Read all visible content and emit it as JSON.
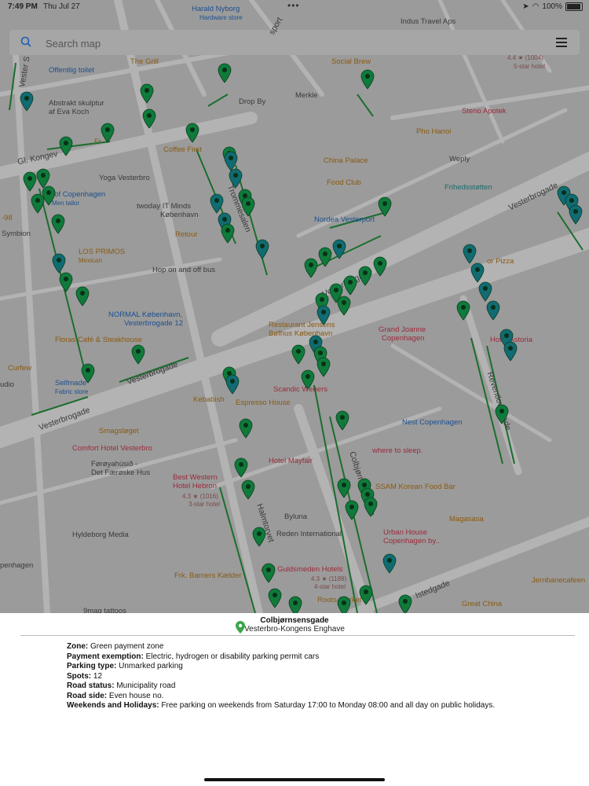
{
  "status_bar": {
    "time": "7:49 PM",
    "date": "Thu Jul 27",
    "battery": "100%"
  },
  "search": {
    "placeholder": "Search map"
  },
  "map": {
    "streets": [
      "Gl. Kongev",
      "Vesterbrogade",
      "Vesterbrogade",
      "Vesterbrogade",
      "Vesterbrogade",
      "Colbjørnsensgade",
      "Reventlowsgade",
      "Istedgade",
      "Trommesalen",
      "Halmtorvet",
      "Vester S",
      "sport"
    ],
    "pois": [
      {
        "name": "Harald Nyborg",
        "sub": "Hardware store",
        "kind": "b"
      },
      {
        "name": "Indus Travel Aps",
        "kind": "g"
      },
      {
        "name": "Offentlig toilet",
        "kind": "b"
      },
      {
        "name": "The Grill",
        "kind": "o"
      },
      {
        "name": "Social Brew",
        "kind": "o"
      },
      {
        "name": "4.4 ★ (1004)",
        "sub": "5-star hotel",
        "kind": "p"
      },
      {
        "name": "Abstrakt skulptur",
        "sub": "af Eva Koch",
        "kind": "g"
      },
      {
        "name": "Drop By",
        "kind": "g"
      },
      {
        "name": "Merkle",
        "kind": "g"
      },
      {
        "name": "Steno Apotek",
        "kind": "p"
      },
      {
        "name": "Pho Hanoi",
        "kind": "o"
      },
      {
        "name": "Coffee First",
        "kind": "o"
      },
      {
        "name": "Yoga Vesterbro",
        "kind": "g"
      },
      {
        "name": "China Palace",
        "kind": "o"
      },
      {
        "name": "Weply",
        "kind": "g"
      },
      {
        "name": "Food Club",
        "kind": "o"
      },
      {
        "name": "Frihedsstøtten",
        "kind": "t"
      },
      {
        "name": "nd of Copenhagen",
        "sub": "Men tailor",
        "kind": "b"
      },
      {
        "name": "twoday IT Minds",
        "sub": "København",
        "kind": "g"
      },
      {
        "name": "Nordea Vesterport",
        "kind": "b"
      },
      {
        "name": "Symbion",
        "kind": "g"
      },
      {
        "name": "Retour",
        "kind": "o"
      },
      {
        "name": "LOS PRIMOS",
        "sub": "Mexican",
        "kind": "o"
      },
      {
        "name": "Hop on and off bus",
        "kind": "g"
      },
      {
        "name": "or Pizza",
        "kind": "o"
      },
      {
        "name": "NORMAL København,",
        "sub": "Vesterbrogade 12",
        "kind": "b"
      },
      {
        "name": "Restaurant Jensens",
        "sub": "Bøfhus København",
        "kind": "o"
      },
      {
        "name": "Grand Joanne",
        "sub": "Copenhagen",
        "kind": "p"
      },
      {
        "name": "Hotel Astoria",
        "kind": "p"
      },
      {
        "name": "Floras Café & Steakhouse",
        "kind": "o"
      },
      {
        "name": "Curfew",
        "kind": "o"
      },
      {
        "name": "Selfmade",
        "sub": "Fabric store",
        "kind": "b"
      },
      {
        "name": "Scandic Webers",
        "kind": "p"
      },
      {
        "name": "Kebabish",
        "kind": "o"
      },
      {
        "name": "Espresso House",
        "kind": "o"
      },
      {
        "name": "Smagsløget",
        "kind": "o"
      },
      {
        "name": "Nest Copenhagen",
        "kind": "b"
      },
      {
        "name": "Comfort Hotel Vesterbro",
        "kind": "p"
      },
      {
        "name": "Hotel Mayfair",
        "kind": "p"
      },
      {
        "name": "where to sleep.",
        "kind": "p"
      },
      {
        "name": "Førøyahúsið -",
        "sub": "Det Færøske Hus",
        "kind": "g"
      },
      {
        "name": "Best Western",
        "sub": "Hotel Hebron",
        "kind": "p"
      },
      {
        "name": "4.3 ★ (1016)",
        "sub": "3-star hotel",
        "kind": "p"
      },
      {
        "name": "SSAM Korean Food Bar",
        "kind": "o"
      },
      {
        "name": "Byluna",
        "kind": "g"
      },
      {
        "name": "Magasasa",
        "kind": "o"
      },
      {
        "name": "Hyldeborg Media",
        "kind": "g"
      },
      {
        "name": "Reden International",
        "kind": "g"
      },
      {
        "name": "Urban House",
        "sub": "Copenhagen by..",
        "kind": "p"
      },
      {
        "name": "penhagen",
        "kind": "g"
      },
      {
        "name": "Frk. Barners Kælder",
        "kind": "o"
      },
      {
        "name": "Axel Guldsmeden Hotels",
        "kind": "p"
      },
      {
        "name": "4.3 ★ (1189)",
        "sub": "4-star hotel",
        "kind": "p"
      },
      {
        "name": "Jernbanecafeen",
        "kind": "o"
      },
      {
        "name": "Roots Market",
        "kind": "o"
      },
      {
        "name": "Great China",
        "kind": "o"
      },
      {
        "name": "9mag tattoos",
        "kind": "g"
      },
      {
        "name": "udio",
        "kind": "g"
      },
      {
        "name": "-98",
        "kind": "o"
      },
      {
        "name": "Fr",
        "kind": "o"
      }
    ]
  },
  "panel": {
    "title": "Colbjørnsensgade",
    "subtitle": "Vesterbro-Kongens Enghave",
    "details": [
      {
        "label": "Zone:",
        "value": "Green payment zone"
      },
      {
        "label": "Payment exemption:",
        "value": "Electric, hydrogen or disability parking permit cars"
      },
      {
        "label": "Parking type:",
        "value": "Unmarked parking"
      },
      {
        "label": "Spots:",
        "value": "12"
      },
      {
        "label": "Road status:",
        "value": "Municipality road"
      },
      {
        "label": "Road side:",
        "value": "Even house no."
      },
      {
        "label": "Weekends and Holidays:",
        "value": "Free parking on weekends from Saturday 17:00 to Monday 08:00 and all day on public holidays."
      }
    ]
  },
  "colors": {
    "marker_green": "#0f7a3a",
    "marker_teal": "#116b72",
    "map_bg": "#9b9b9b",
    "road": "#b1b1b1"
  }
}
